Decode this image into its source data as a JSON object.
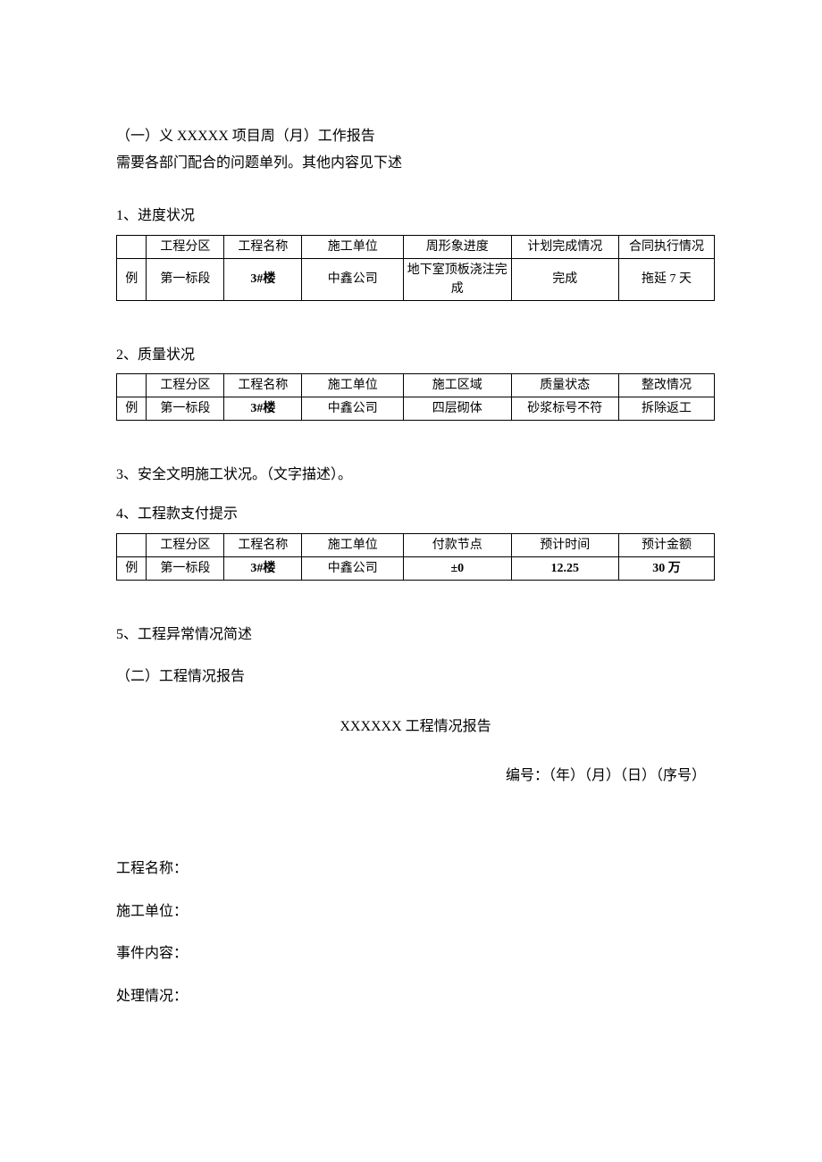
{
  "intro": {
    "line1": "（一）义 XXXXX 项目周（月）工作报告",
    "line2": "需要各部门配合的问题单列。其他内容见下述"
  },
  "section1": {
    "heading": "1、进度状况",
    "headers": [
      "",
      "工程分区",
      "工程名称",
      "施工单位",
      "周形象进度",
      "计划完成情况",
      "合同执行情况"
    ],
    "row": [
      "例",
      "第一标段",
      "3#楼",
      "中鑫公司",
      "地下室顶板浇注完成",
      "完成",
      "拖延 7 天"
    ]
  },
  "section2": {
    "heading": "2、质量状况",
    "headers": [
      "",
      "工程分区",
      "工程名称",
      "施工单位",
      "施工区域",
      "质量状态",
      "整改情况"
    ],
    "row": [
      "例",
      "第一标段",
      "3#楼",
      "中鑫公司",
      "四层砌体",
      "砂浆标号不符",
      "拆除返工"
    ]
  },
  "section3": {
    "heading": "3、安全文明施工状况。（文字描述）。"
  },
  "section4": {
    "heading": "4、工程款支付提示",
    "headers": [
      "",
      "工程分区",
      "工程名称",
      "施工单位",
      "付款节点",
      "预计时间",
      "预计金额"
    ],
    "row": [
      "例",
      "第一标段",
      "3#楼",
      "中鑫公司",
      "±0",
      "12.25",
      "30 万"
    ]
  },
  "section5": {
    "heading": "5、工程异常情况简述"
  },
  "part2": {
    "heading": "（二）工程情况报告",
    "title": "XXXXXX 工程情况报告",
    "numbering": "编号：（年）（月）（日）（序号）",
    "fields": {
      "f1": "工程名称：",
      "f2": "施工单位：",
      "f3": "事件内容：",
      "f4": "处理情况："
    }
  }
}
